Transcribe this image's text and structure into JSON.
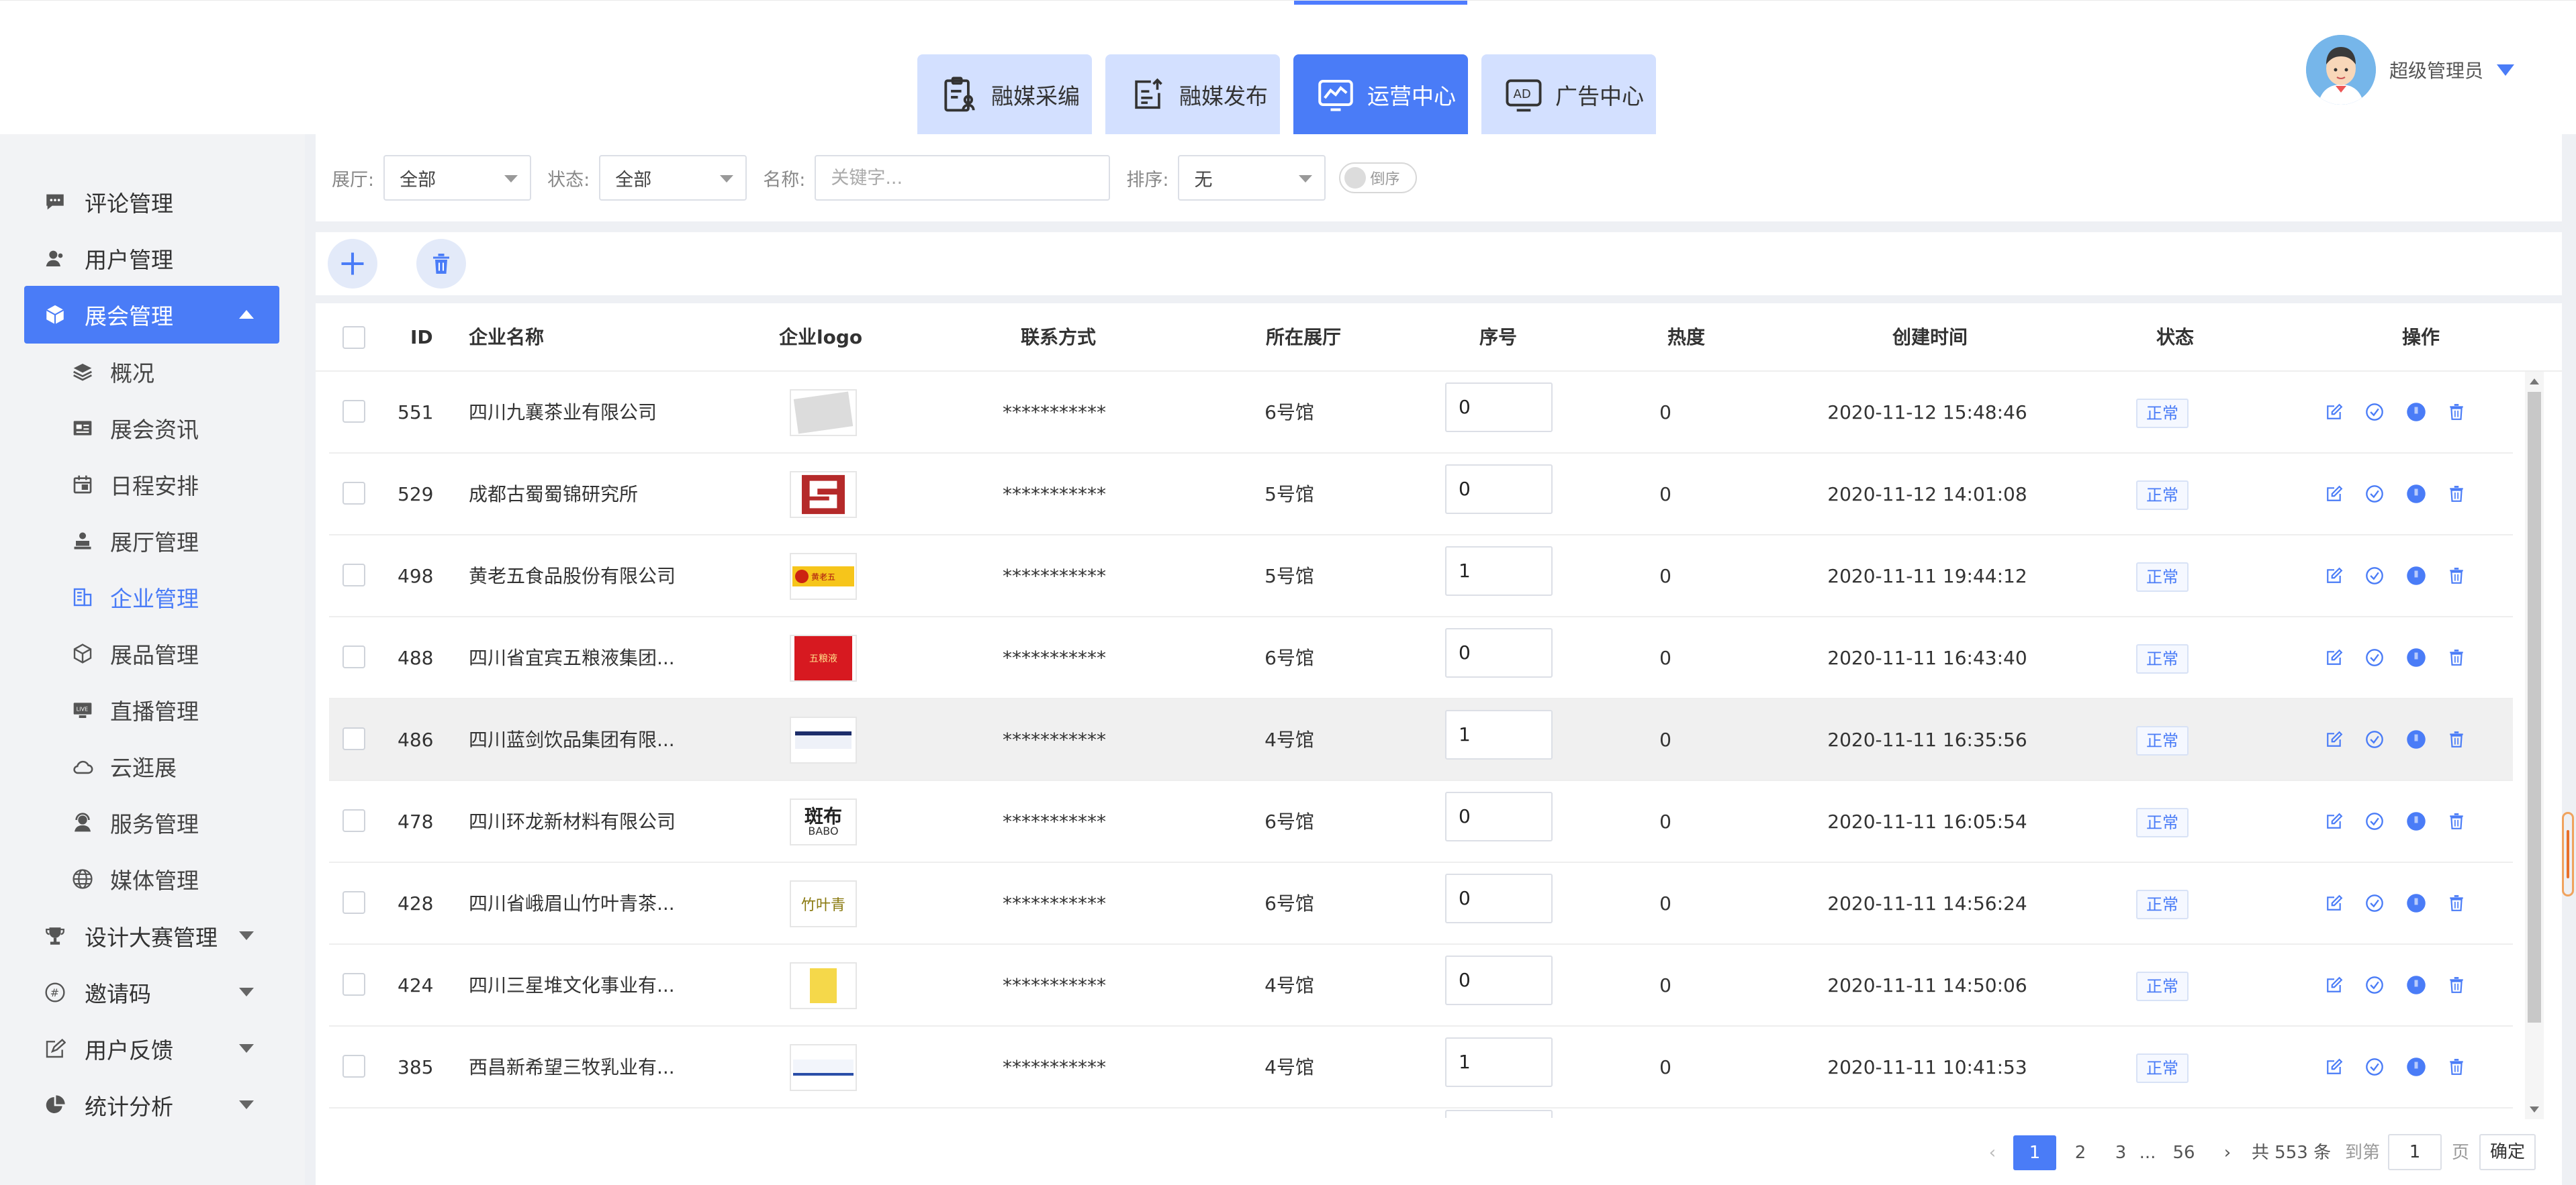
{
  "header": {
    "tabs": [
      {
        "label": "融媒采编",
        "icon": "clipboard-edit-icon"
      },
      {
        "label": "融媒发布",
        "icon": "publish-icon"
      },
      {
        "label": "运营中心",
        "icon": "chart-monitor-icon"
      },
      {
        "label": "广告中心",
        "icon": "ad-icon"
      }
    ],
    "user": {
      "name": "超级管理员",
      "avatar": "user-avatar"
    }
  },
  "sidebar": {
    "items": [
      {
        "label": "评论管理",
        "icon": "comment-icon"
      },
      {
        "label": "用户管理",
        "icon": "user-icon"
      },
      {
        "label": "展会管理",
        "icon": "exhibition-icon"
      },
      {
        "label": "设计大赛管理",
        "icon": "trophy-icon"
      },
      {
        "label": "邀请码",
        "icon": "code-icon"
      },
      {
        "label": "用户反馈",
        "icon": "feedback-icon"
      },
      {
        "label": "统计分析",
        "icon": "pie-chart-icon"
      }
    ],
    "sub_items": [
      {
        "label": "概况",
        "icon": "layers-icon"
      },
      {
        "label": "展会资讯",
        "icon": "news-icon"
      },
      {
        "label": "日程安排",
        "icon": "calendar-icon"
      },
      {
        "label": "展厅管理",
        "icon": "hall-icon"
      },
      {
        "label": "企业管理",
        "icon": "building-icon"
      },
      {
        "label": "展品管理",
        "icon": "box-icon"
      },
      {
        "label": "直播管理",
        "icon": "live-icon"
      },
      {
        "label": "云逛展",
        "icon": "cloud-icon"
      },
      {
        "label": "服务管理",
        "icon": "service-icon"
      },
      {
        "label": "媒体管理",
        "icon": "globe-icon"
      }
    ]
  },
  "filters": {
    "hall_label": "展厅:",
    "hall_value": "全部",
    "status_label": "状态:",
    "status_value": "全部",
    "name_label": "名称:",
    "name_placeholder": "关键字...",
    "sort_label": "排序:",
    "sort_value": "无",
    "desc_toggle": "倒序"
  },
  "table": {
    "columns": [
      "ID",
      "企业名称",
      "企业logo",
      "联系方式",
      "所在展厅",
      "序号",
      "热度",
      "创建时间",
      "状态",
      "操作"
    ],
    "rows": [
      {
        "id": "551",
        "name": "四川九襄茶业有限公司",
        "contact": "***********",
        "hall": "6号馆",
        "seq": "0",
        "heat": "0",
        "created": "2020-11-12 15:48:46",
        "status": "正常"
      },
      {
        "id": "529",
        "name": "成都古蜀蜀锦研究所",
        "contact": "***********",
        "hall": "5号馆",
        "seq": "0",
        "heat": "0",
        "created": "2020-11-12 14:01:08",
        "status": "正常"
      },
      {
        "id": "498",
        "name": "黄老五食品股份有限公司",
        "contact": "***********",
        "hall": "5号馆",
        "seq": "1",
        "heat": "0",
        "created": "2020-11-11 19:44:12",
        "status": "正常"
      },
      {
        "id": "488",
        "name": "四川省宜宾五粮液集团...",
        "contact": "***********",
        "hall": "6号馆",
        "seq": "0",
        "heat": "0",
        "created": "2020-11-11 16:43:40",
        "status": "正常"
      },
      {
        "id": "486",
        "name": "四川蓝剑饮品集团有限...",
        "contact": "***********",
        "hall": "4号馆",
        "seq": "1",
        "heat": "0",
        "created": "2020-11-11 16:35:56",
        "status": "正常"
      },
      {
        "id": "478",
        "name": "四川环龙新材料有限公司",
        "contact": "***********",
        "hall": "6号馆",
        "seq": "0",
        "heat": "0",
        "created": "2020-11-11 16:05:54",
        "status": "正常"
      },
      {
        "id": "428",
        "name": "四川省峨眉山竹叶青茶...",
        "contact": "***********",
        "hall": "6号馆",
        "seq": "0",
        "heat": "0",
        "created": "2020-11-11 14:56:24",
        "status": "正常"
      },
      {
        "id": "424",
        "name": "四川三星堆文化事业有...",
        "contact": "***********",
        "hall": "4号馆",
        "seq": "0",
        "heat": "0",
        "created": "2020-11-11 14:50:06",
        "status": "正常"
      },
      {
        "id": "385",
        "name": "西昌新希望三牧乳业有...",
        "contact": "***********",
        "hall": "4号馆",
        "seq": "1",
        "heat": "0",
        "created": "2020-11-11 10:41:53",
        "status": "正常"
      }
    ],
    "logo_texts": {
      "r5": "斑布",
      "r5b": "BABO",
      "r6": "竹叶青",
      "r3": "五粮液",
      "r2": "黄老五"
    }
  },
  "pagination": {
    "pages": [
      "1",
      "2",
      "3",
      "...",
      "56"
    ],
    "total": "共 553 条",
    "goto_label": "到第",
    "goto_value": "1",
    "page_unit": "页",
    "confirm": "确定"
  },
  "colors": {
    "accent": "#4a7cf7",
    "tab_bg": "#d3e0ff"
  }
}
